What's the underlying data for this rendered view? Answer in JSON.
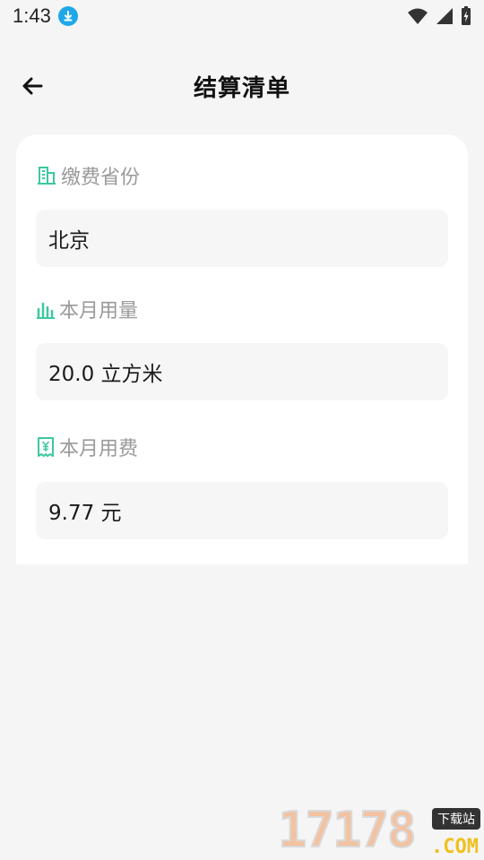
{
  "status_bar": {
    "time": "1:43",
    "icons": [
      "download-icon",
      "wifi-icon",
      "signal-icon",
      "battery-icon"
    ]
  },
  "app_bar": {
    "title": "结算清单",
    "back_icon": "arrow-left-icon"
  },
  "sections": [
    {
      "label": "缴费省份",
      "icon": "building-icon",
      "value": "北京"
    },
    {
      "label": "本月用量",
      "icon": "bar-chart-icon",
      "value": "20.0 立方米"
    },
    {
      "label": "本月用费",
      "icon": "yuan-receipt-icon",
      "value": "9.77 元"
    }
  ],
  "watermark": {
    "digits": "17178",
    "tag": "下载站",
    "suffix": ".COM"
  },
  "colors": {
    "accent": "#3cc8a0",
    "background": "#f5f5f5",
    "card": "#ffffff",
    "field": "#f6f6f6",
    "label": "#9a9a9a"
  }
}
